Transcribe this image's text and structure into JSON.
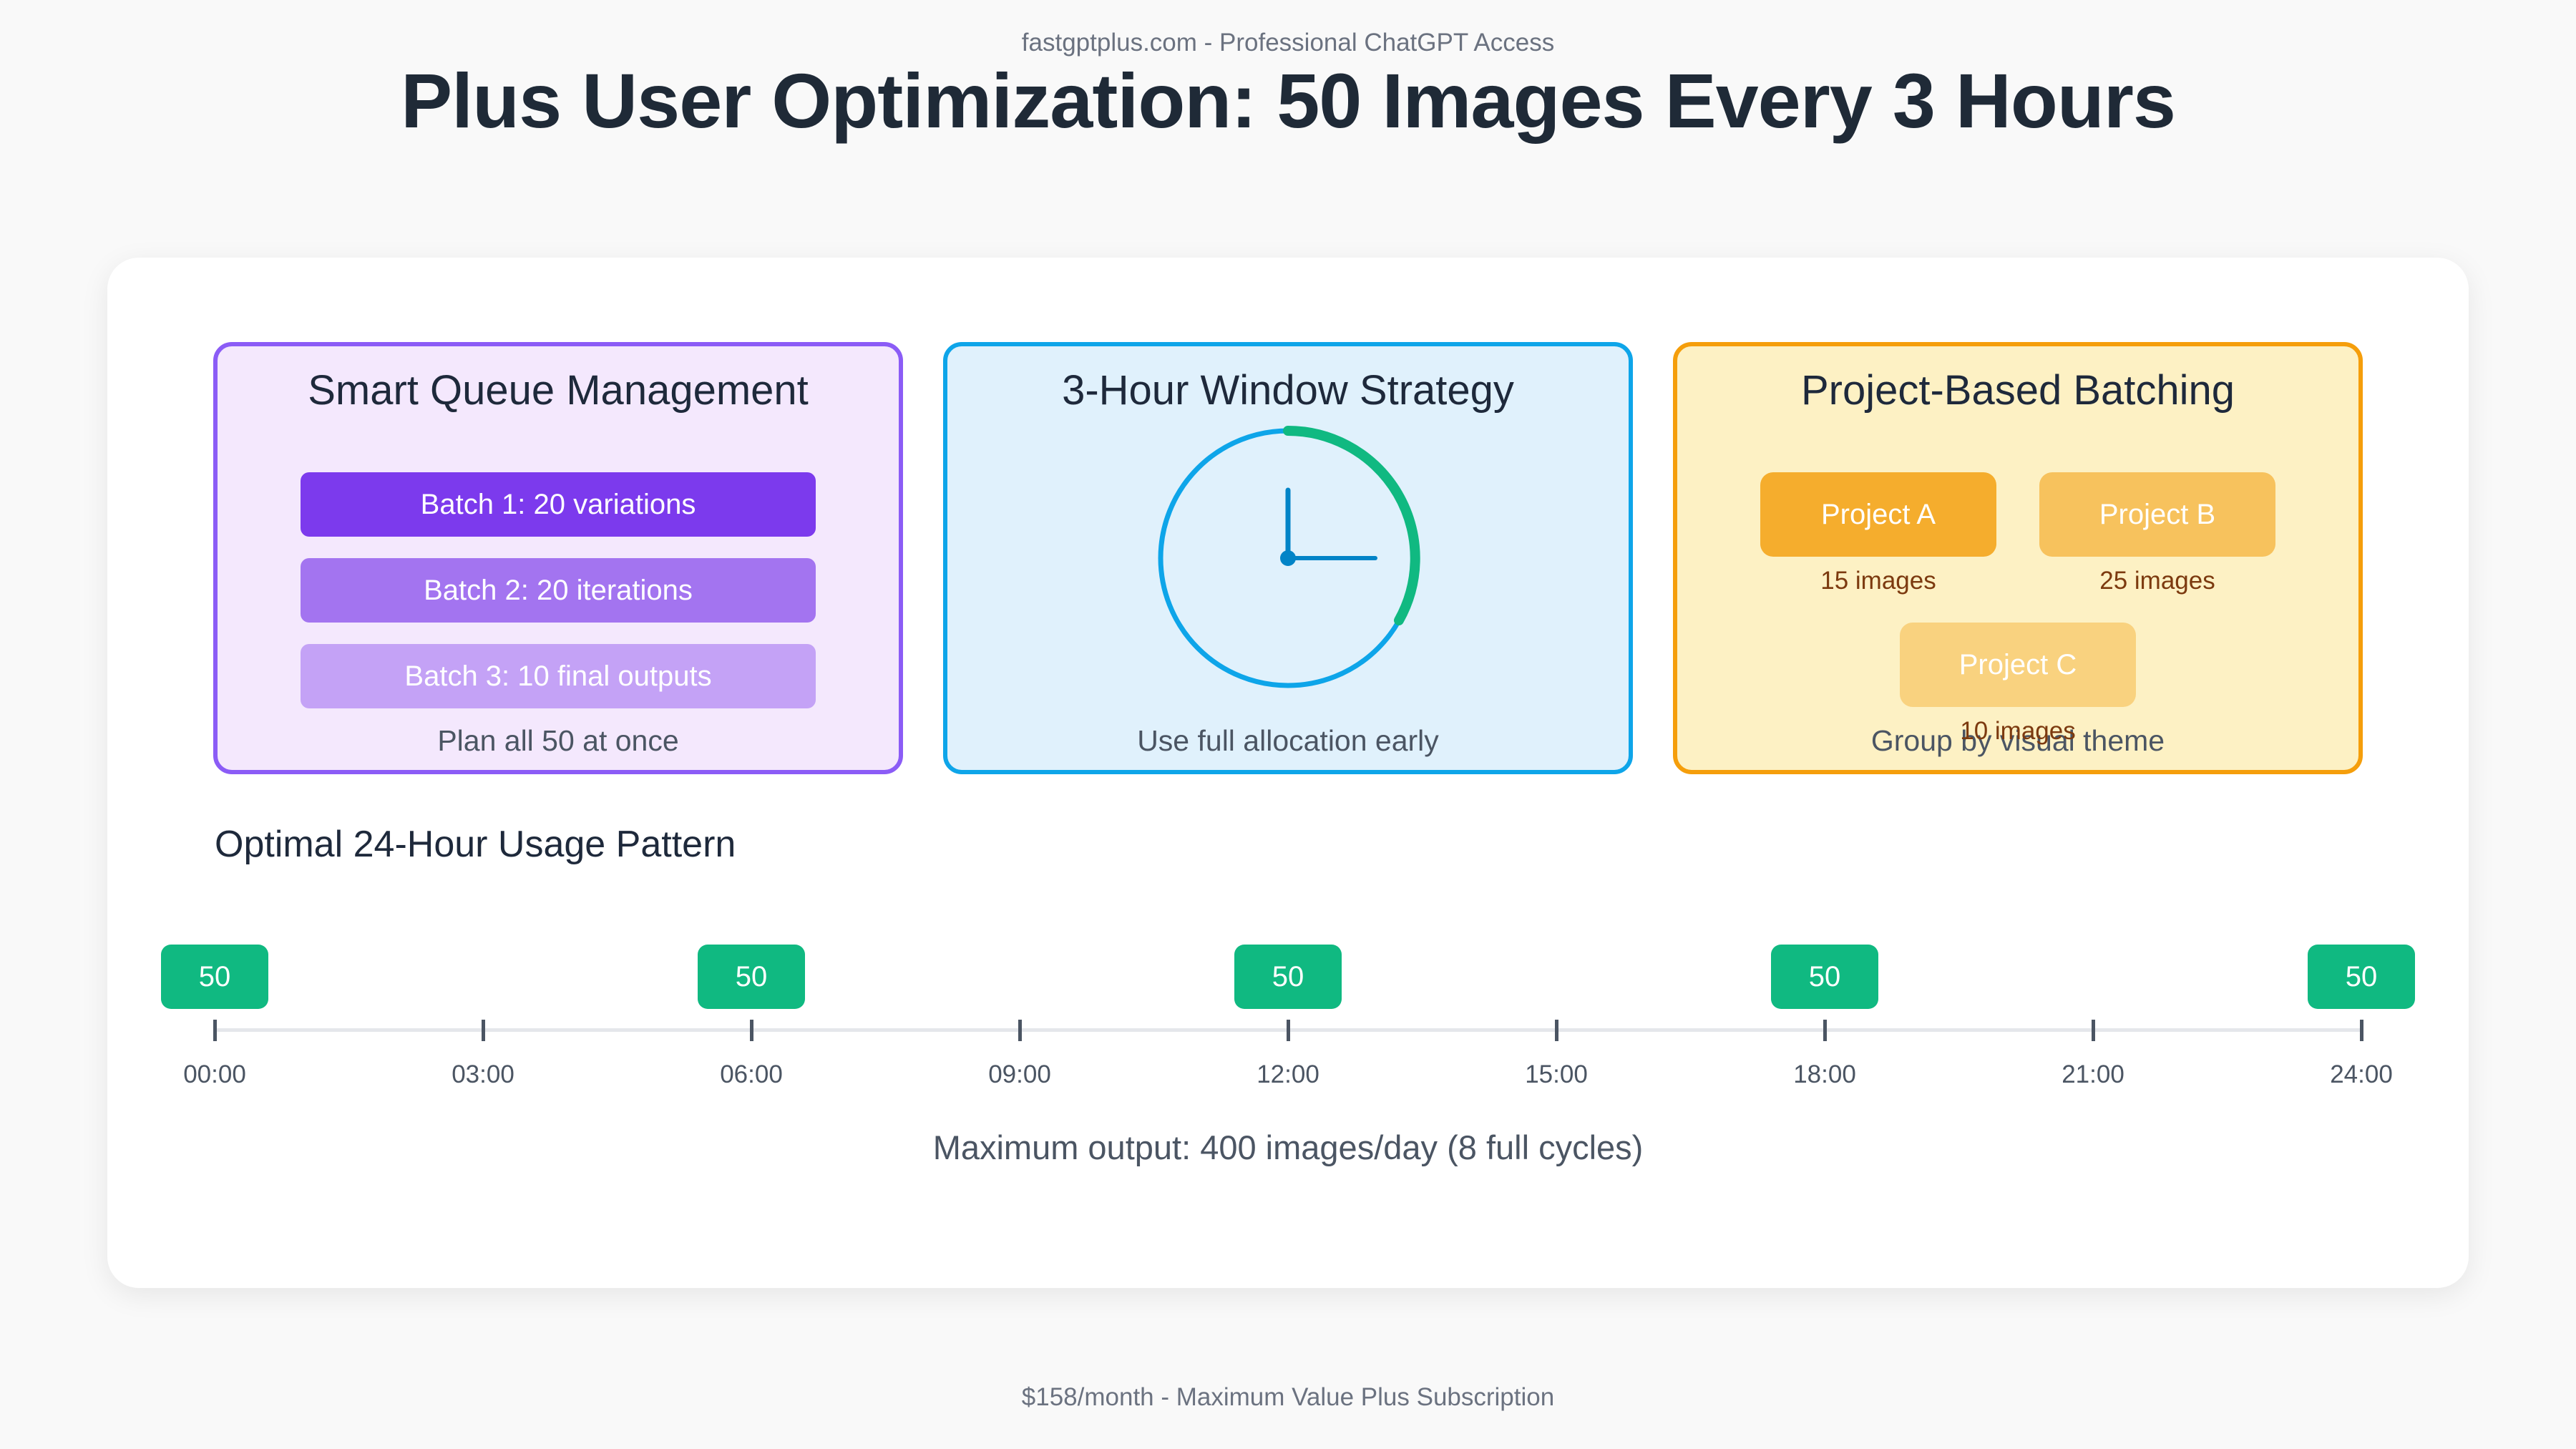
{
  "header": {
    "site": "fastgptplus.com - Professional ChatGPT Access",
    "title": "Plus User Optimization: 50 Images Every 3 Hours"
  },
  "panels": {
    "queue": {
      "title": "Smart Queue Management",
      "batches": [
        "Batch 1: 20 variations",
        "Batch 2: 20 iterations",
        "Batch 3: 10 final outputs"
      ],
      "subtitle": "Plan all 50 at once"
    },
    "window": {
      "title": "3-Hour Window Strategy",
      "icon": "clock-icon",
      "subtitle": "Use full allocation early"
    },
    "project": {
      "title": "Project-Based Batching",
      "projects": [
        {
          "name": "Project A",
          "count": "15 images"
        },
        {
          "name": "Project B",
          "count": "25 images"
        },
        {
          "name": "Project C",
          "count": "10 images"
        }
      ],
      "subtitle": "Group by visual theme"
    }
  },
  "timeline": {
    "title": "Optimal 24-Hour Usage Pattern",
    "ticks": [
      "00:00",
      "03:00",
      "06:00",
      "09:00",
      "12:00",
      "15:00",
      "18:00",
      "21:00",
      "24:00"
    ],
    "pill_value": "50",
    "pill_hours": [
      0,
      6,
      12,
      18,
      24
    ]
  },
  "summary": "Maximum output: 400 images/day (8 full cycles)",
  "footer": "$158/month - Maximum Value Plus Subscription",
  "colors": {
    "purple": "#8b5cf6",
    "blue": "#0ea5e9",
    "amber": "#f59e0b",
    "green": "#10b981"
  }
}
